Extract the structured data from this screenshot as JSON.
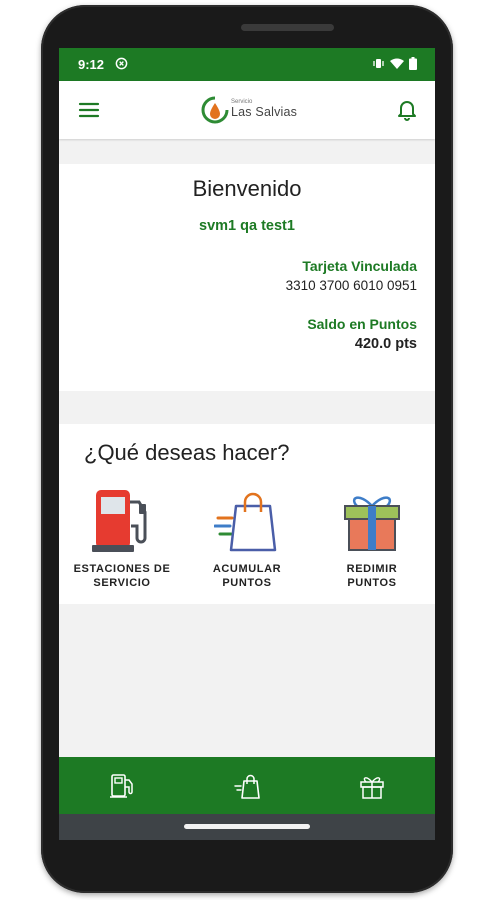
{
  "status_bar": {
    "time": "9:12",
    "icons": [
      "sync-icon",
      "vibrate-icon",
      "wifi-icon",
      "battery-icon"
    ]
  },
  "app_bar": {
    "logo_small": "Servicio",
    "logo_name": "Las Salvias",
    "icons": [
      "menu-icon",
      "bell-icon"
    ]
  },
  "welcome": {
    "title": "Bienvenido",
    "user_name": "svm1 qa test1",
    "card_label": "Tarjeta Vinculada",
    "card_number": "3310 3700 6010 0951",
    "points_label": "Saldo en Puntos",
    "points_value": "420.0 pts"
  },
  "actions": {
    "title": "¿Qué deseas hacer?",
    "items": [
      {
        "label": "ESTACIONES DE\nSERVICIO",
        "icon": "fuel-pump-icon"
      },
      {
        "label": "ACUMULAR\nPUNTOS",
        "icon": "shopping-bag-icon"
      },
      {
        "label": "REDIMIR\nPUNTOS",
        "icon": "gift-icon"
      }
    ]
  },
  "bottom_nav": {
    "items": [
      "fuel-pump-nav-icon",
      "shopping-bag-nav-icon",
      "gift-nav-icon"
    ]
  },
  "colors": {
    "brand_green": "#1d7a24",
    "background": "#f2f2f2",
    "nav_bar": "#3e4347"
  }
}
